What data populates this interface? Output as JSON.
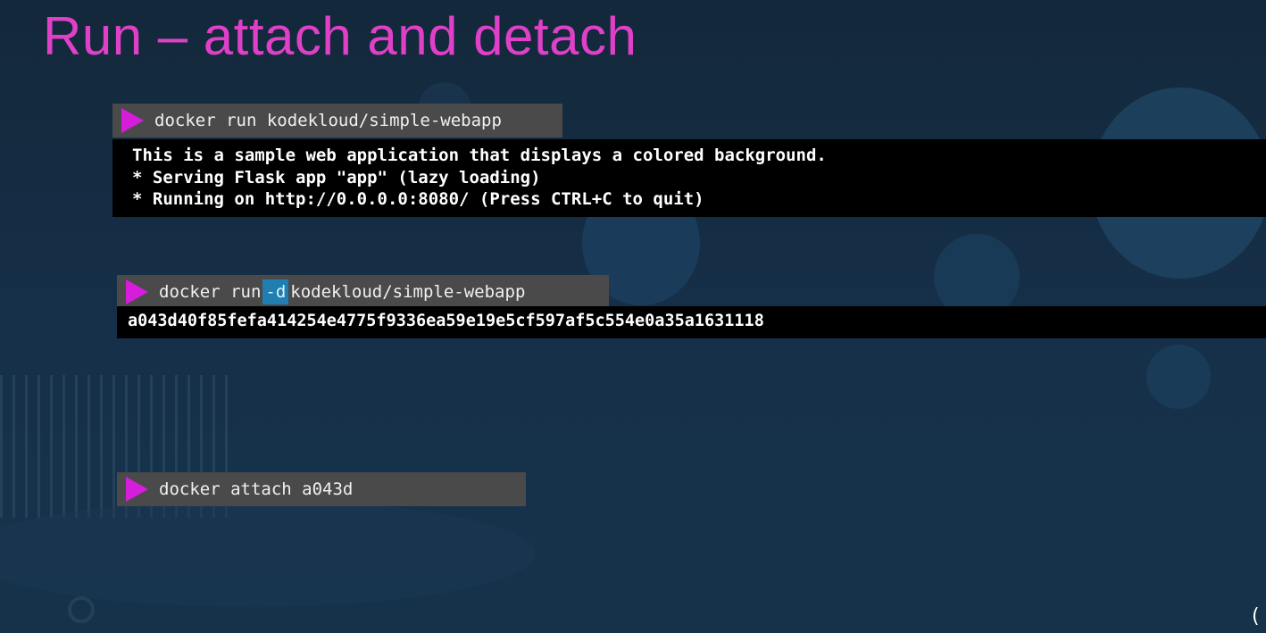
{
  "slide": {
    "title": "Run – attach and detach"
  },
  "commands": [
    {
      "prefix": "docker run kodekloud/simple-webapp",
      "output_lines": [
        "This is a sample web application that displays a colored background.",
        "* Serving Flask app \"app\" (lazy loading)",
        "* Running on http://0.0.0.0:8080/ (Press CTRL+C to quit)"
      ]
    },
    {
      "prefix": "docker run",
      "flag": "-d",
      "suffix": "kodekloud/simple-webapp",
      "output": "a043d40f85fefa414254e4775f9336ea59e19e5cf597af5c554e0a35a1631118"
    },
    {
      "prefix": "docker attach a043d"
    }
  ],
  "colors": {
    "title": "#e040c8",
    "prompt_arrow": "#d51ddb",
    "command_bg": "#4a4a4a",
    "flag_highlight": "#1f7fb0",
    "output_bg": "#000000"
  },
  "icons": [
    "play-arrow-icon"
  ]
}
